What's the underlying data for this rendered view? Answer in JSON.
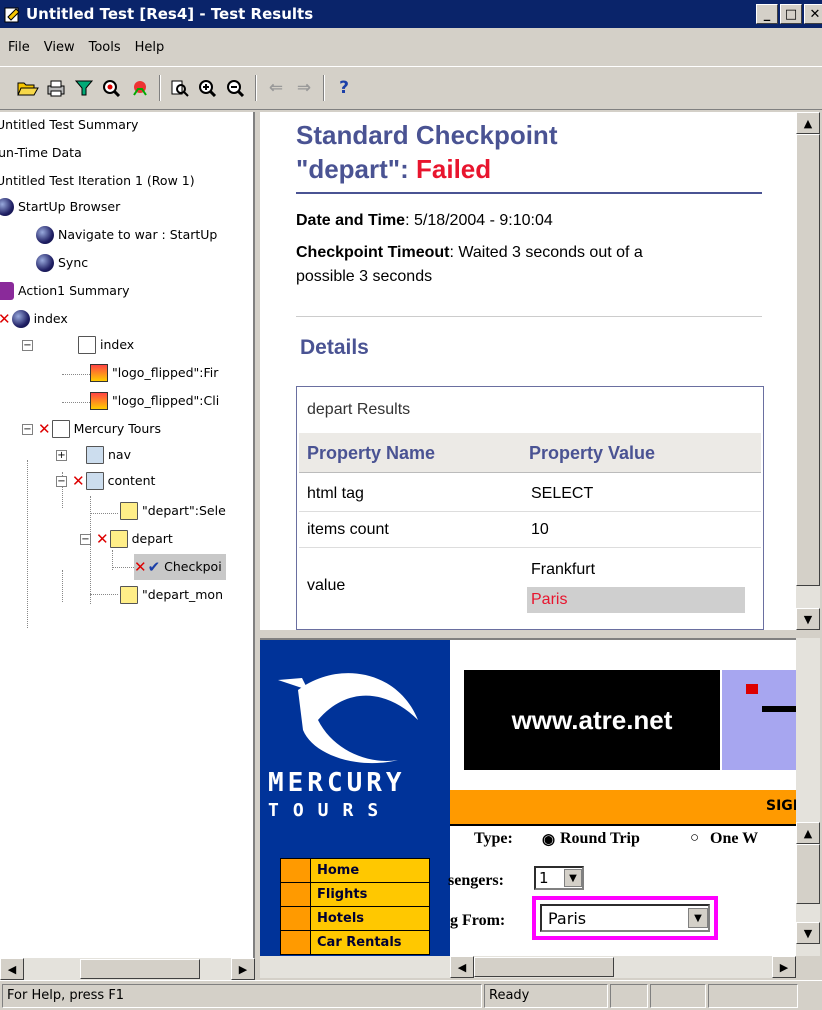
{
  "window": {
    "title": "Untitled Test [Res4] - Test Results",
    "min": "_",
    "max": "□",
    "close": "✕"
  },
  "menu": [
    "File",
    "View",
    "Tools",
    "Help"
  ],
  "toolbar": {
    "help": "?"
  },
  "tree": {
    "items": [
      "Untitled Test Summary",
      "Run-Time Data",
      "Untitled Test Iteration 1 (Row 1)",
      "StartUp Browser",
      "Navigate to war : StartUp",
      "Sync",
      "Action1 Summary",
      "index",
      "index",
      "\"logo_flipped\":Fir",
      "\"logo_flipped\":Cli",
      "Mercury Tours",
      "nav",
      "content",
      "\"depart\":Sele",
      "depart",
      "Checkpoi",
      "\"depart_mon"
    ]
  },
  "report": {
    "title_line1": "Standard Checkpoint",
    "title_line2": "\"depart\": ",
    "status": "Failed",
    "date_label": "Date and Time",
    "date_value": ": 5/18/2004 - 9:10:04",
    "timeout_label": "Checkpoint Timeout",
    "timeout_value": ": Waited 3 seconds out of a",
    "timeout_value2": "possible 3 seconds",
    "details": "Details",
    "results_title": "depart Results",
    "col_name": "Property Name",
    "col_value": "Property Value",
    "rows": [
      {
        "name": "html tag",
        "value": "SELECT"
      },
      {
        "name": "items count",
        "value": "10"
      },
      {
        "name": "value",
        "value": "Frankfurt",
        "value2": "Paris"
      }
    ]
  },
  "browser": {
    "logo1": "MERCURY",
    "logo2": "TOURS",
    "banner": "www.atre.net",
    "sign": "SIGN",
    "nav": [
      "Home",
      "Flights",
      "Hotels",
      "Car Rentals"
    ],
    "type_label": "Type:",
    "round_trip": "Round Trip",
    "one_way": "One W",
    "passengers_label": "sengers:",
    "passengers_value": "1",
    "from_label": "g From:",
    "from_value": "Paris"
  },
  "status": {
    "help": "For Help, press F1",
    "ready": "Ready"
  },
  "colors": {
    "title_bar": "#0a246a",
    "report_heading": "#4a5393",
    "failed": "#e8152e",
    "highlight": "#ff00ff"
  }
}
